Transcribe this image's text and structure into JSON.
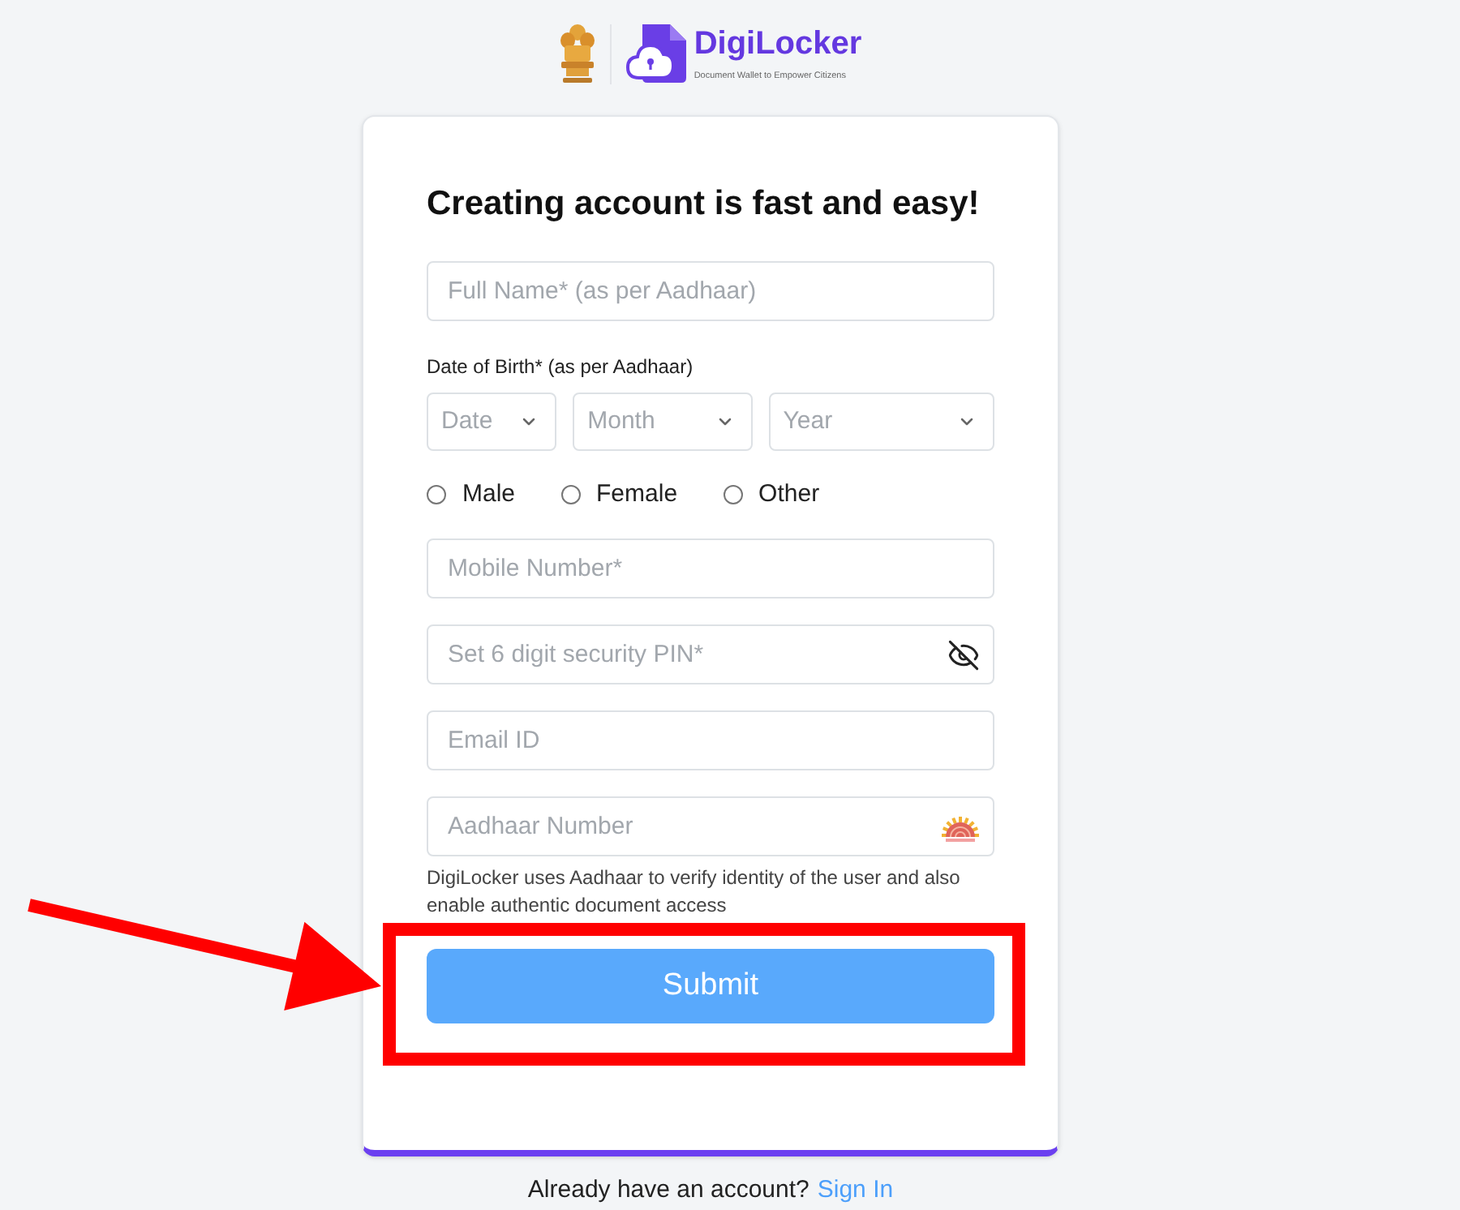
{
  "header": {
    "brand": "DigiLocker",
    "tagline": "Document Wallet to Empower Citizens"
  },
  "form": {
    "title": "Creating account is fast and easy!",
    "full_name": {
      "placeholder": "Full Name* (as per Aadhaar)"
    },
    "dob": {
      "label": "Date of Birth* (as per Aadhaar)",
      "selects": [
        {
          "placeholder": "Date"
        },
        {
          "placeholder": "Month"
        },
        {
          "placeholder": "Year"
        }
      ]
    },
    "gender": [
      {
        "label": "Male",
        "selected": false
      },
      {
        "label": "Female",
        "selected": false
      },
      {
        "label": "Other",
        "selected": false
      }
    ],
    "inputs": [
      {
        "kind": "plain",
        "placeholder": "Mobile Number*"
      },
      {
        "kind": "password",
        "placeholder": "Set 6 digit security PIN*"
      },
      {
        "kind": "plain",
        "placeholder": "Email ID"
      },
      {
        "kind": "aadhaar",
        "placeholder": "Aadhaar Number"
      }
    ],
    "note": "DigiLocker uses Aadhaar to verify identity of the user and also enable authentic document access",
    "submit": "Submit"
  },
  "footer": {
    "text": "Already have an account?",
    "link": "Sign In"
  },
  "annotations": {
    "arrow": true,
    "highlight_frame": true
  }
}
